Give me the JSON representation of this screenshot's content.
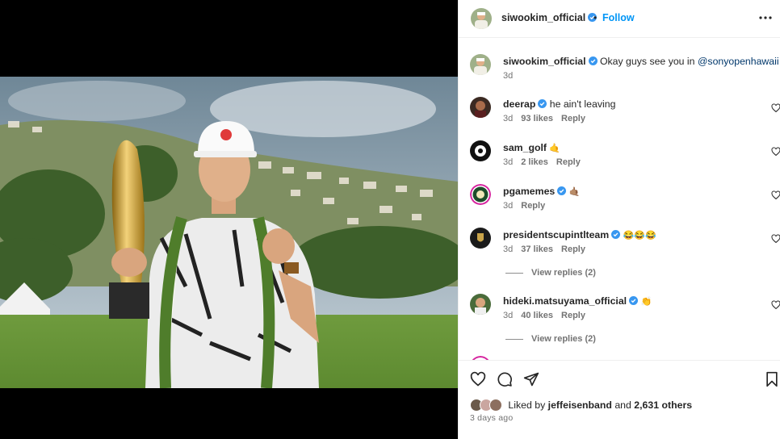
{
  "post": {
    "author": "siwookim_official",
    "follow_label": "Follow",
    "dot": "•",
    "caption": "Okay guys see you in",
    "caption_mention": "@sonyopenhawaii",
    "caption_time": "3d",
    "liked_by_prefix": "Liked by",
    "liked_by_user": "jeffeisenband",
    "liked_by_and": "and",
    "liked_by_others": "2,631 others",
    "time_ago": "3 days ago"
  },
  "comments": [
    {
      "user": "deerap",
      "text": "he ain't leaving",
      "time": "3d",
      "likes": "93 likes",
      "reply": "Reply"
    },
    {
      "user": "sam_golf",
      "text": "🤙",
      "time": "3d",
      "likes": "2 likes",
      "reply": "Reply"
    },
    {
      "user": "pgamemes",
      "text": "🤙🏽",
      "time": "3d",
      "likes": "",
      "reply": "Reply"
    },
    {
      "user": "presidentscupintlteam",
      "text": "😂😂😂",
      "time": "3d",
      "likes": "37 likes",
      "reply": "Reply",
      "view_replies": "View replies (2)"
    },
    {
      "user": "hideki.matsuyama_official",
      "text": "👏",
      "time": "3d",
      "likes": "40 likes",
      "reply": "Reply",
      "view_replies": "View replies (2)"
    }
  ],
  "colors": {
    "accent": "#0095f6",
    "verified": "#3897f0",
    "muted": "#737373"
  }
}
